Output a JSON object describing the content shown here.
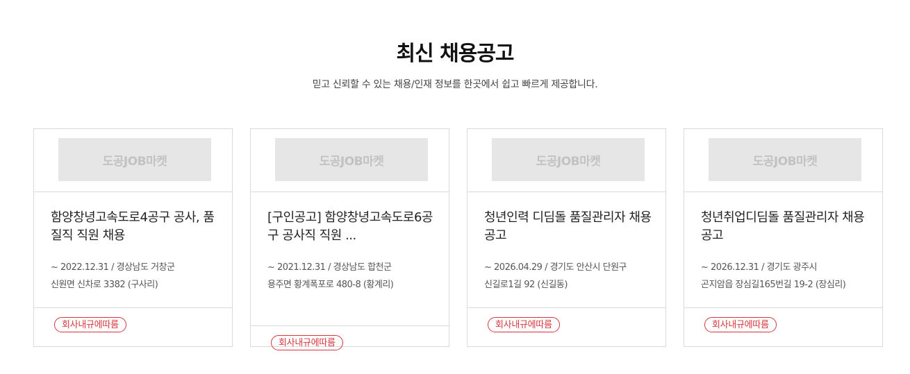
{
  "section": {
    "title": "최신 채용공고",
    "subtitle": "믿고 신뢰할 수 있는 채용/인재 정보를 한곳에서 쉽고 빠르게 제공합니다."
  },
  "cards": [
    {
      "logo": "도공JOB마켓",
      "title": "함양창녕고속도로4공구 공사, 품질직 직원 채용",
      "date_location": "~ 2022.12.31 / 경상남도 거창군",
      "address": "신원면 신차로 3382 (구사리)",
      "badge": "회사내규에따름"
    },
    {
      "logo": "도공JOB마켓",
      "title": "[구인공고] 함양창녕고속도로6공구 공사직 직원 ...",
      "date_location": "~ 2021.12.31 / 경상남도 합천군",
      "address": "용주면 황계폭포로 480-8 (황계리)",
      "badge": "회사내규에따름"
    },
    {
      "logo": "도공JOB마켓",
      "title": "청년인력 디딤돌 품질관리자 채용공고",
      "date_location": "~ 2026.04.29 / 경기도 안산시 단원구",
      "address": "신길로1길 92 (신길동)",
      "badge": "회사내규에따름"
    },
    {
      "logo": "도공JOB마켓",
      "title": "청년취업디딤돌 품질관리자 채용 공고",
      "date_location": "~ 2026.12.31 / 경기도 광주시",
      "address": "곤지암읍 장심길165번길 19-2 (장심리)",
      "badge": "회사내규에따름"
    }
  ],
  "colors": {
    "badge": "#d9363e",
    "border": "#d9d9d9",
    "logo_bg": "#e6e6e6"
  }
}
